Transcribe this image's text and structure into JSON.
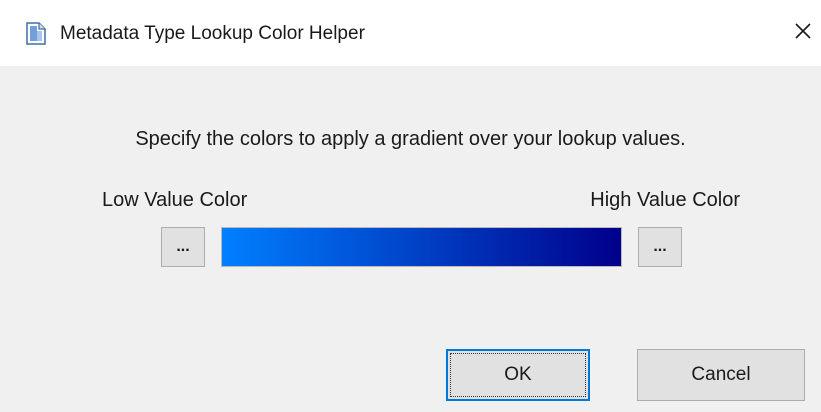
{
  "window": {
    "title": "Metadata Type Lookup Color Helper",
    "title_icon": "document-icon",
    "close_glyph": "✕"
  },
  "dialog": {
    "instruction": "Specify the colors to apply a gradient over your lookup values.",
    "low_label": "Low Value Color",
    "high_label": "High Value Color",
    "low_button_label": "...",
    "high_button_label": "...",
    "gradient": {
      "low_color": "#0080ff",
      "high_color": "#00008b"
    },
    "ok_label": "OK",
    "cancel_label": "Cancel"
  },
  "colors": {
    "accent": "#0078d7",
    "window_bg": "#f0f0f0",
    "titlebar_bg": "#ffffff"
  }
}
